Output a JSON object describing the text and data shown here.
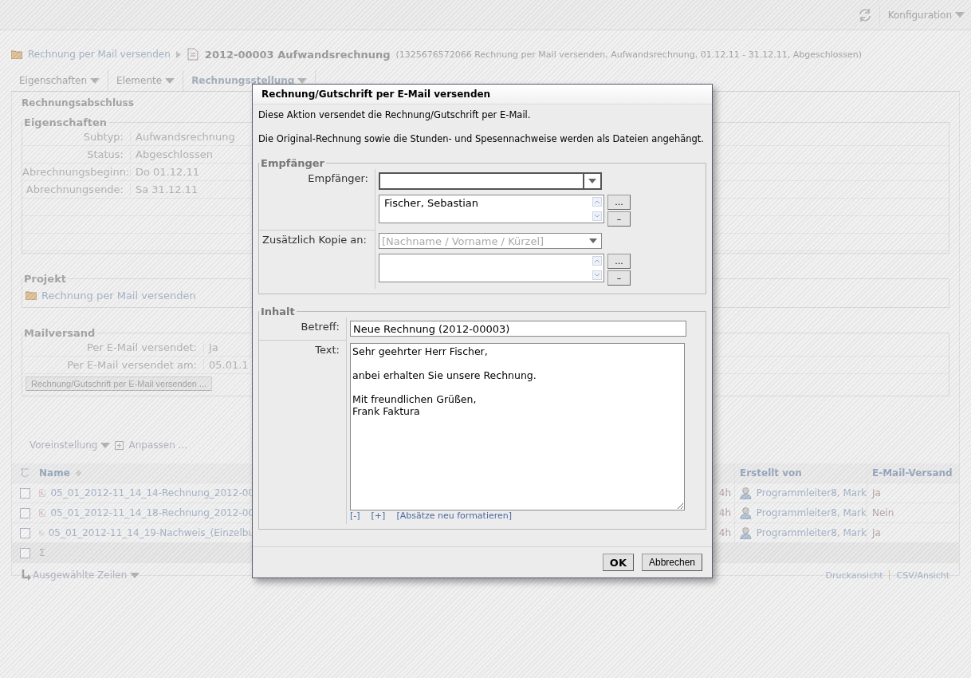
{
  "toolbar": {
    "menu": "Konfiguration"
  },
  "breadcrumb": {
    "parent": "Rechnung per Mail versenden",
    "title": "2012-00003 Aufwandsrechnung",
    "details": "(1325676572066 Rechnung per Mail versenden, Aufwandsrechnung, 01.12.11 - 31.12.11, Abgeschlossen)"
  },
  "tabs": [
    {
      "label": "Eigenschaften",
      "selected": false
    },
    {
      "label": "Elemente",
      "selected": false
    },
    {
      "label": "Rechnungsstellung",
      "selected": true
    }
  ],
  "section_title": "Rechnungsabschluss",
  "properties": {
    "legend": "Eigenschaften",
    "rows": [
      {
        "label": "Subtyp:",
        "value": "Aufwandsrechnung"
      },
      {
        "label": "Status:",
        "value": "Abgeschlossen"
      },
      {
        "label": "Abrechnungsbeginn:",
        "value": "Do 01.12.11"
      },
      {
        "label": "Abrechnungsende:",
        "value": "Sa 31.12.11"
      }
    ]
  },
  "project": {
    "legend": "Projekt",
    "link": "Rechnung per Mail versenden"
  },
  "mail": {
    "legend": "Mailversand",
    "rows": [
      {
        "label": "Per E-Mail versendet:",
        "value": "Ja"
      },
      {
        "label": "Per E-Mail versendet am:",
        "value": "05.01.1"
      }
    ],
    "button": "Rechnung/Gutschrift per E-Mail versenden ..."
  },
  "table": {
    "preset": "Voreinstellung",
    "customize": "Anpassen ...",
    "columns": {
      "name": "Name",
      "created_by": "Erstellt von",
      "email": "E-Mail-Versand"
    },
    "rows": [
      {
        "checked": false,
        "name": "05_01_2012-11_14_14-Rechnung_2012-00",
        "column_3": "4h",
        "created_by": "Programmleiter8, Mark",
        "email": "Ja"
      },
      {
        "checked": false,
        "name": "05_01_2012-11_14_18-Rechnung_2012-00",
        "column_3": "4h",
        "created_by": "Programmleiter8, Mark",
        "email": "Nein"
      },
      {
        "checked": false,
        "name": "05_01_2012-11_14_19-Nachweis_(Einzelbu",
        "column_3": "4h",
        "created_by": "Programmleiter8, Mark",
        "email": "Ja"
      }
    ],
    "sum": {
      "checked": false,
      "symbol": "Σ"
    },
    "selected_rows": "Ausgewählte Zeilen",
    "links": [
      "Druckansicht",
      "CSV/Ansicht"
    ]
  },
  "dialog": {
    "title": "Rechnung/Gutschrift per E-Mail versenden",
    "intro": [
      "Diese Aktion versendet die Rechnung/Gutschrift per E-Mail.",
      "Die Original-Rechnung sowie die Stunden- und Spesennachweise werden als Dateien angehängt."
    ],
    "recipients": {
      "legend": "Empfänger",
      "to": {
        "label": "Empfänger:",
        "items": [
          "Fischer, Sebastian"
        ]
      },
      "cc": {
        "label": "Zusätzlich Kopie an:",
        "placeholder": "[Nachname / Vorname / Kürzel]"
      },
      "add_button": "...",
      "remove_button": "–"
    },
    "content": {
      "legend": "Inhalt",
      "subject_label": "Betreff:",
      "subject": "Neue Rechnung (2012-00003)",
      "text_label": "Text:",
      "text": "Sehr geehrter Herr Fischer,\n\nanbei erhalten Sie unsere Rechnung.\n\nMit freundlichen Grüßen,\nFrank Faktura",
      "links": [
        "[-]",
        "[+]",
        "[Absätze neu formatieren]"
      ]
    },
    "buttons": {
      "ok": "OK",
      "cancel": "Abbrechen"
    }
  }
}
